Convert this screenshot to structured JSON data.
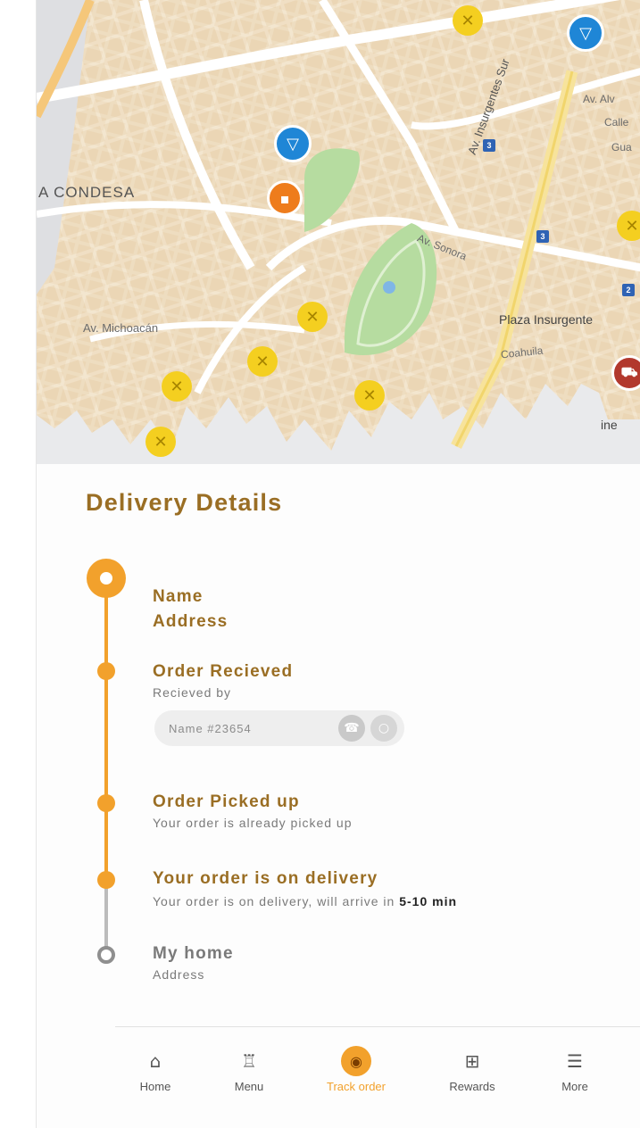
{
  "map": {
    "labels": {
      "condesa": "A CONDESA",
      "michoacan": "Av. Michoacán",
      "sonora": "Av. Sonora",
      "insurgentes_sur": "Av. Insurgentes Sur",
      "plaza": "Plaza Insurgente",
      "coahuila": "Coahuila",
      "ine": "ine",
      "calle": "Calle",
      "gua": "Gua",
      "av_alv": "Av. Alv"
    },
    "metro_badges": [
      "3",
      "3",
      "2"
    ]
  },
  "delivery": {
    "title": "Delivery Details",
    "origin": {
      "name": "Name",
      "address": "Address"
    },
    "steps": [
      {
        "title": "Order Recieved",
        "subtitle": "Recieved by"
      },
      {
        "title": "Order Picked up",
        "subtitle": "Your order is already picked up"
      },
      {
        "title": "Your order is on delivery",
        "subtitle_prefix": "Your order is on delivery, will arrive in ",
        "subtitle_bold": "5-10 min"
      },
      {
        "title": "My home",
        "subtitle": "Address"
      }
    ],
    "courier": {
      "text": "Name  #23654"
    }
  },
  "nav": {
    "items": [
      {
        "label": "Home",
        "icon": "home-icon"
      },
      {
        "label": "Menu",
        "icon": "menu-cup-icon"
      },
      {
        "label": "Track order",
        "icon": "track-order-icon",
        "active": true
      },
      {
        "label": "Rewards",
        "icon": "gift-icon"
      },
      {
        "label": "More",
        "icon": "hamburger-icon"
      }
    ]
  },
  "colors": {
    "accent": "#f2a12c",
    "title_brown": "#9a6e24",
    "muted": "#7a7a7a"
  }
}
